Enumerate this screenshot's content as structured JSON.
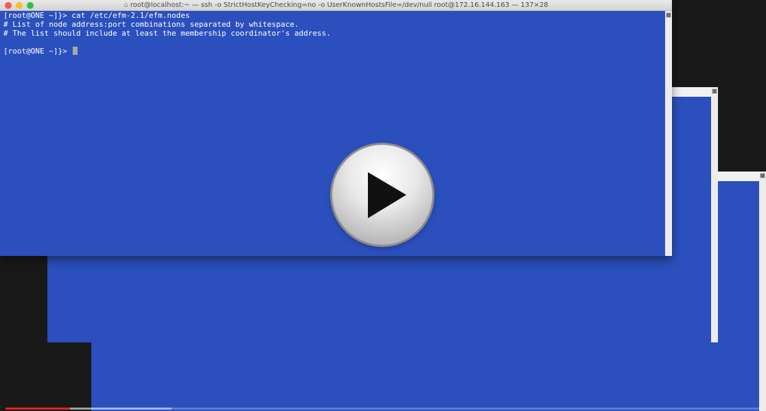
{
  "window": {
    "title": "root@localhost:~ — ssh -o StrictHostKeyChecking=no -o UserKnownHostsFile=/dev/null root@172.16.144.163 — 137×28",
    "title_icon": "home-icon"
  },
  "terminal": {
    "lines": [
      "[root@ONE ~]}> cat /etc/efm-2.1/efm.nodes",
      "# List of node address:port combinations separated by whitespace.",
      "# The list should include at least the membership coordinator's address.",
      "",
      "[root@ONE ~]}> "
    ]
  },
  "colors": {
    "terminal_bg": "#2b50bd",
    "terminal_fg": "#ffffff",
    "progress_played": "#e62117"
  },
  "video": {
    "played_fraction": 0.085,
    "buffered_fraction": 0.22
  }
}
